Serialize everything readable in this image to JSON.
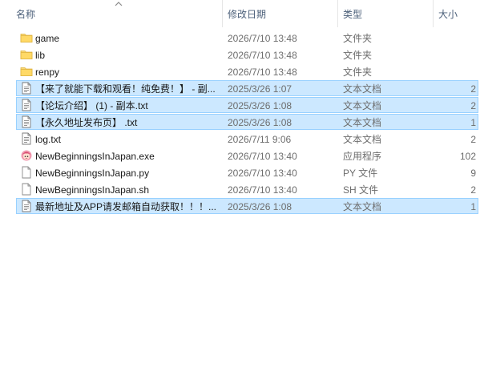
{
  "columns": {
    "name": "名称",
    "date": "修改日期",
    "type": "类型",
    "size": "大小"
  },
  "sort": {
    "column": "name",
    "icon": "sort-up-chevron-icon"
  },
  "files": [
    {
      "name": "game",
      "date": "2026/7/10 13:48",
      "type": "文件夹",
      "size": "",
      "icon": "folder",
      "selected": false
    },
    {
      "name": "lib",
      "date": "2026/7/10 13:48",
      "type": "文件夹",
      "size": "",
      "icon": "folder",
      "selected": false
    },
    {
      "name": "renpy",
      "date": "2026/7/10 13:48",
      "type": "文件夹",
      "size": "",
      "icon": "folder",
      "selected": false
    },
    {
      "name": "【来了就能下载和观看！纯免费！】 - 副...",
      "date": "2025/3/26 1:07",
      "type": "文本文档",
      "size": "2",
      "icon": "text",
      "selected": true
    },
    {
      "name": "【论坛介绍】 (1) - 副本.txt",
      "date": "2025/3/26 1:08",
      "type": "文本文档",
      "size": "2",
      "icon": "text",
      "selected": true
    },
    {
      "name": "【永久地址发布页】 .txt",
      "date": "2025/3/26 1:08",
      "type": "文本文档",
      "size": "1",
      "icon": "text",
      "selected": true
    },
    {
      "name": "log.txt",
      "date": "2026/7/11 9:06",
      "type": "文本文档",
      "size": "2",
      "icon": "text",
      "selected": false
    },
    {
      "name": "NewBeginningsInJapan.exe",
      "date": "2026/7/10 13:40",
      "type": "应用程序",
      "size": "102",
      "icon": "app",
      "selected": false
    },
    {
      "name": "NewBeginningsInJapan.py",
      "date": "2026/7/10 13:40",
      "type": "PY 文件",
      "size": "9",
      "icon": "file",
      "selected": false
    },
    {
      "name": "NewBeginningsInJapan.sh",
      "date": "2026/7/10 13:40",
      "type": "SH 文件",
      "size": "2",
      "icon": "file",
      "selected": false
    },
    {
      "name": "最新地址及APP请发邮箱自动获取！！！...",
      "date": "2025/3/26 1:08",
      "type": "文本文档",
      "size": "1",
      "icon": "text",
      "selected": true
    }
  ]
}
